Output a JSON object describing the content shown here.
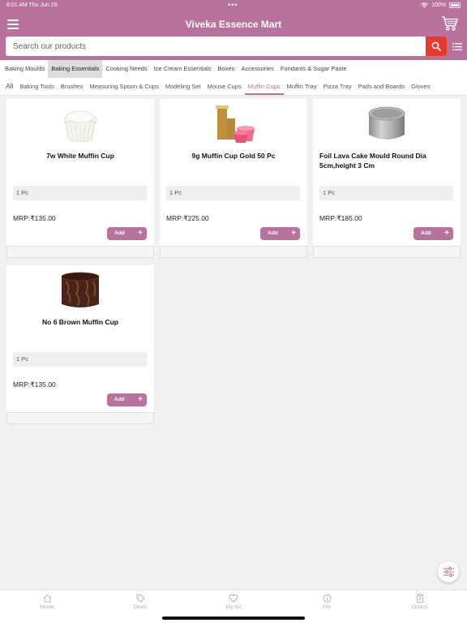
{
  "status_bar": {
    "time": "8:01 AM  Thu Jun 29",
    "battery": "100%"
  },
  "header": {
    "title": "Viveka Essence Mart"
  },
  "search": {
    "placeholder": "Search our products"
  },
  "categories": [
    {
      "label": "Baking Moulds"
    },
    {
      "label": "Baking Essentials"
    },
    {
      "label": "Cooking Needs"
    },
    {
      "label": "Ice Cream Essentials"
    },
    {
      "label": "Boxes"
    },
    {
      "label": "Accessories"
    },
    {
      "label": "Fondants & Sugar Paste"
    }
  ],
  "subcategories": [
    {
      "label": "All"
    },
    {
      "label": "Baking Tools"
    },
    {
      "label": "Brushes"
    },
    {
      "label": "Measuring Spoon & Cups"
    },
    {
      "label": "Modeling Set"
    },
    {
      "label": "Mouse Cups"
    },
    {
      "label": "Muffin Cups"
    },
    {
      "label": "Muffin Tray"
    },
    {
      "label": "Pizza Tray"
    },
    {
      "label": "Pads and Boards"
    },
    {
      "label": "Gloves"
    }
  ],
  "products": [
    {
      "name": "7w White Muffin Cup",
      "unit": "1 Pc",
      "mrp": "MRP:₹135.00",
      "add_label": "Add",
      "image_icon": "white-muffin-cup-icon"
    },
    {
      "name": "9g Muffin Cup Gold 50 Pc",
      "unit": "1 Pc",
      "mrp": "MRP:₹225.00",
      "add_label": "Add",
      "image_icon": "gold-muffin-cups-icon"
    },
    {
      "name": "Foil Lava Cake Mould Round Dia 5cm,height 3 Cm",
      "unit": "1 Pc",
      "mrp": "MRP:₹185.00",
      "add_label": "Add",
      "image_icon": "foil-cake-mould-icon"
    },
    {
      "name": "No 6 Brown Muffin Cup",
      "unit": "1 Pc",
      "mrp": "MRP:₹135.00",
      "add_label": "Add",
      "image_icon": "brown-muffin-cup-icon"
    }
  ],
  "tabs": [
    {
      "label": "Home",
      "icon": "home-icon"
    },
    {
      "label": "Deals",
      "icon": "tag-icon"
    },
    {
      "label": "My list",
      "icon": "heart-icon"
    },
    {
      "label": "Info",
      "icon": "info-icon"
    },
    {
      "label": "Orders",
      "icon": "clipboard-icon"
    }
  ],
  "colors": {
    "brand": "#b9729b",
    "search_button": "#e8392b",
    "background": "#f1f1f1"
  }
}
